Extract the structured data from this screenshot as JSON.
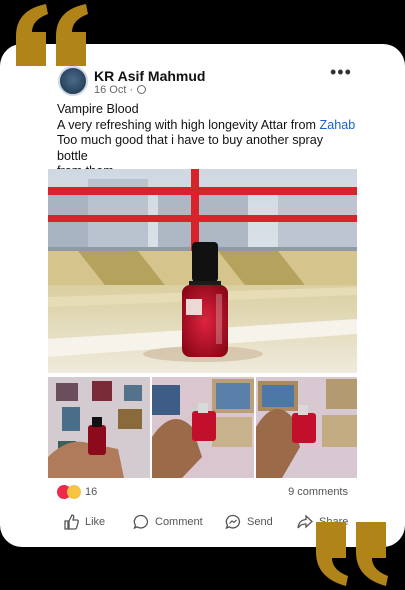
{
  "post": {
    "author": "KR Asif Mahmud",
    "date": "16 Oct",
    "separator": "·",
    "more_menu": "•••",
    "text_line1": "Vampire Blood",
    "text_line2_prefix": "A very refreshing with high longevity Attar from ",
    "text_mention": "Zahab",
    "text_line3": "Too much good that i have to buy another spray bottle",
    "text_line4": "from them."
  },
  "engagement": {
    "reaction_count": "16",
    "comments": "9 comments"
  },
  "actions": {
    "like": "Like",
    "comment": "Comment",
    "send": "Send",
    "share": "Share"
  },
  "colors": {
    "quote_gold": "#b08418",
    "mention_blue": "#1763cf",
    "bottle_red": "#c20f2b",
    "rail_red": "#d8232a"
  },
  "icons": {
    "open_quote": "open-quote-icon",
    "close_quote": "close-quote-icon",
    "globe": "globe-icon",
    "like": "thumbs-up-icon",
    "comment": "comment-bubble-icon",
    "send": "messenger-icon",
    "share": "share-arrow-icon"
  }
}
